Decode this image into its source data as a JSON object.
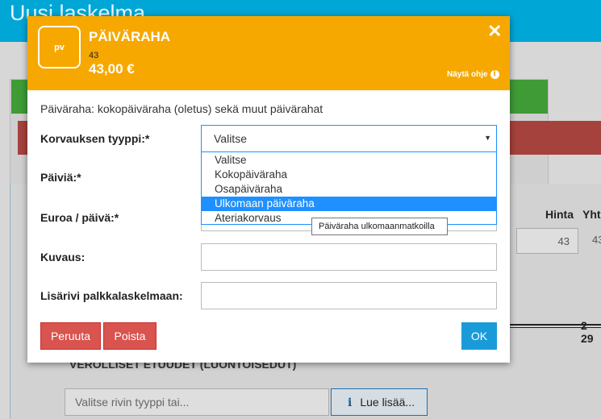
{
  "page": {
    "title": "Uusi laskelma"
  },
  "background": {
    "columns": {
      "price": "Hinta",
      "total": "Yhte"
    },
    "row_price": "43",
    "row_total": "43",
    "grand_total": "2 29",
    "section_heading": "VEROLLISET ETUUDET (LUONTOISEDUT)",
    "row_type_placeholder": "Valitse rivin tyyppi tai...",
    "add_more_label": "Lue lisää..."
  },
  "modal": {
    "badge": "pv",
    "title": "PÄIVÄRAHA",
    "code": "43",
    "amount": "43,00 €",
    "close_glyph": "✕",
    "help_label": "Näytä ohje",
    "description": "Päiväraha: kokopäiväraha (oletus) sekä muut päivärahat",
    "fields": {
      "type_label": "Korvauksen tyyppi:*",
      "type_value": "Valitse",
      "days_label": "Päiviä:*",
      "euro_label": "Euroa / päivä:*",
      "desc_label": "Kuvaus:",
      "extra_label": "Lisärivi palkkalaskelmaan:"
    },
    "options": [
      "Valitse",
      "Kokopäiväraha",
      "Osapäiväraha",
      "Ulkomaan päiväraha",
      "Ateriakorvaus"
    ],
    "selected_option": "Ulkomaan päiväraha",
    "tooltip": "Päiväraha ulkomaanmatkoilla",
    "buttons": {
      "cancel": "Peruuta",
      "delete": "Poista",
      "ok": "OK"
    }
  },
  "colors": {
    "accent": "#f6a800",
    "primary": "#1a9bd9",
    "danger": "#d9534f",
    "header": "#00a6d6"
  },
  "icons": {
    "close": "close-icon",
    "info": "info-icon",
    "caret": "chevron-down-icon"
  }
}
